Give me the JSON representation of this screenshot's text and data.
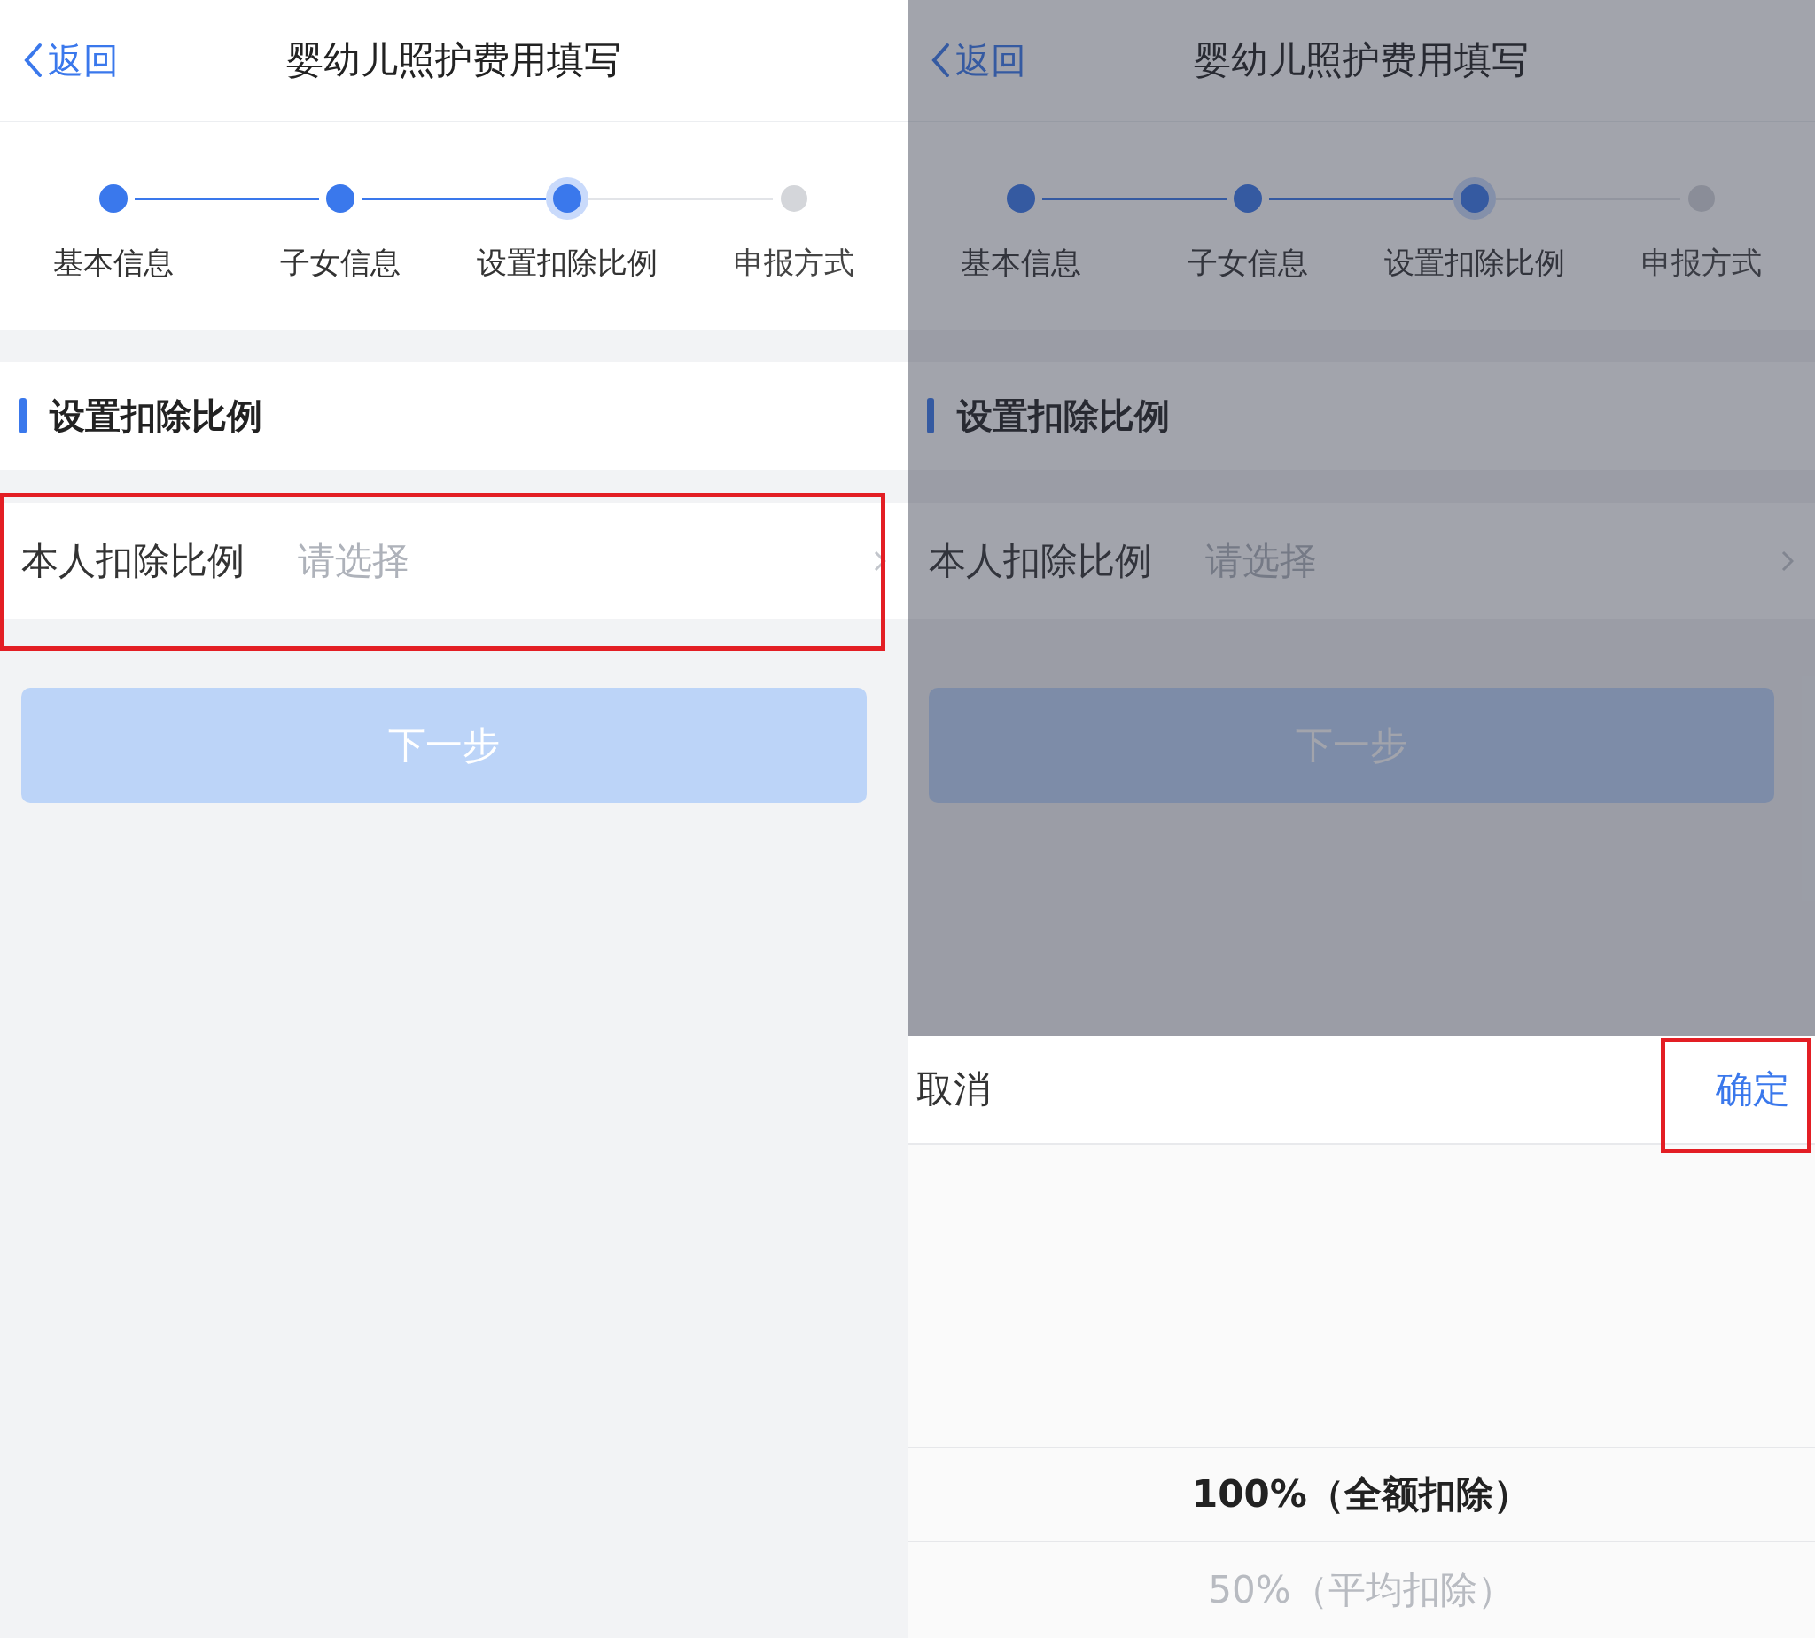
{
  "screens": [
    {
      "back": "返回",
      "title": "婴幼儿照护费用填写",
      "steps": [
        {
          "label": "基本信息",
          "done": true,
          "current": false
        },
        {
          "label": "子女信息",
          "done": true,
          "current": false
        },
        {
          "label": "设置扣除比例",
          "done": false,
          "current": true
        },
        {
          "label": "申报方式",
          "done": false,
          "current": false
        }
      ],
      "section_title": "设置扣除比例",
      "row": {
        "label": "本人扣除比例",
        "placeholder": "请选择",
        "highlighted": true
      },
      "next_button": {
        "label": "下一步",
        "disabled": true
      },
      "dimmed": false
    },
    {
      "back": "返回",
      "title": "婴幼儿照护费用填写",
      "steps": [
        {
          "label": "基本信息",
          "done": true,
          "current": false
        },
        {
          "label": "子女信息",
          "done": true,
          "current": false
        },
        {
          "label": "设置扣除比例",
          "done": false,
          "current": true
        },
        {
          "label": "申报方式",
          "done": false,
          "current": false
        }
      ],
      "section_title": "设置扣除比例",
      "row": {
        "label": "本人扣除比例",
        "placeholder": "请选择",
        "highlighted": false
      },
      "next_button": {
        "label": "下一步",
        "disabled": true
      },
      "dimmed": true,
      "picker": {
        "cancel": "取消",
        "confirm": {
          "label": "确定",
          "highlighted": true
        },
        "options": [
          {
            "label": "100%（全额扣除）",
            "selected": true
          },
          {
            "label": "50%（平均扣除）",
            "selected": false
          }
        ]
      }
    }
  ]
}
